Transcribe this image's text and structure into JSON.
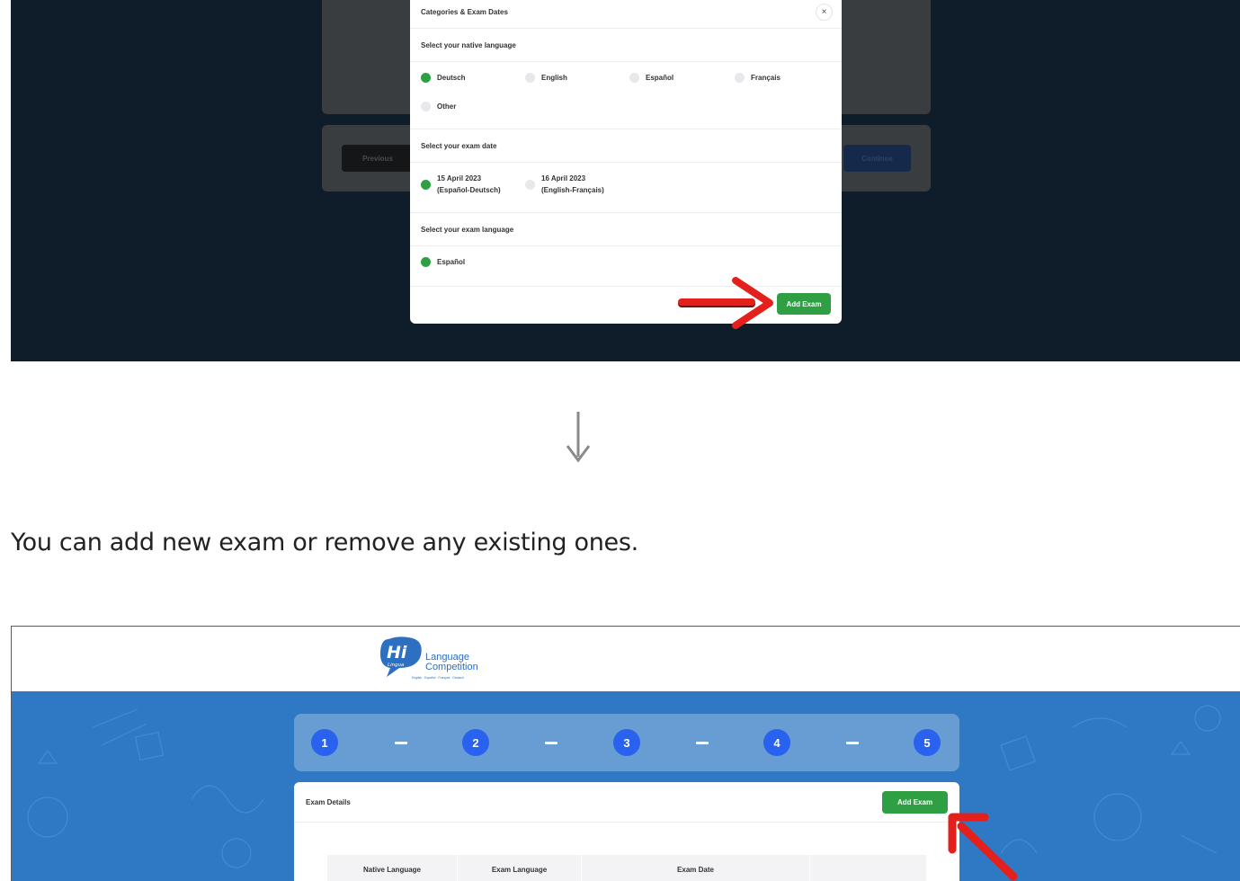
{
  "modal": {
    "title": "Categories & Exam Dates",
    "close_symbol": "×",
    "native_section": "Select your native language",
    "native_options": [
      "Deutsch",
      "English",
      "Español",
      "Français",
      "Other"
    ],
    "native_selected": "Deutsch",
    "date_section": "Select your exam date",
    "date_options": [
      {
        "line1": "15 April 2023",
        "line2": "(Español-Deutsch)"
      },
      {
        "line1": "16 April 2023",
        "line2": "(English-Français)"
      }
    ],
    "exam_language_section": "Select your exam language",
    "exam_language_options": [
      "Español"
    ],
    "add_exam_label": "Add Exam"
  },
  "background_page": {
    "previous_label": "Previous",
    "continue_label": "Continue"
  },
  "caption": "You can add new exam or remove any existing ones.",
  "site": {
    "logo_hi": "Hi",
    "logo_lingua": "Lingua",
    "logo_line1": "Language",
    "logo_line2": "Competition",
    "logo_tagline": "English · Español · Français · Deutsch"
  },
  "stepper": {
    "steps": [
      "1",
      "2",
      "3",
      "4",
      "5"
    ]
  },
  "exam_panel": {
    "title": "Exam Details",
    "add_exam_label": "Add Exam",
    "columns": [
      "Native Language",
      "Exam Language",
      "Exam Date",
      ""
    ]
  },
  "colors": {
    "green": "#2ea043",
    "navy": "#0f1d2b",
    "banner_blue": "#2f78c3",
    "step_blue": "#2962ef",
    "arrow_red": "#e3201b"
  }
}
